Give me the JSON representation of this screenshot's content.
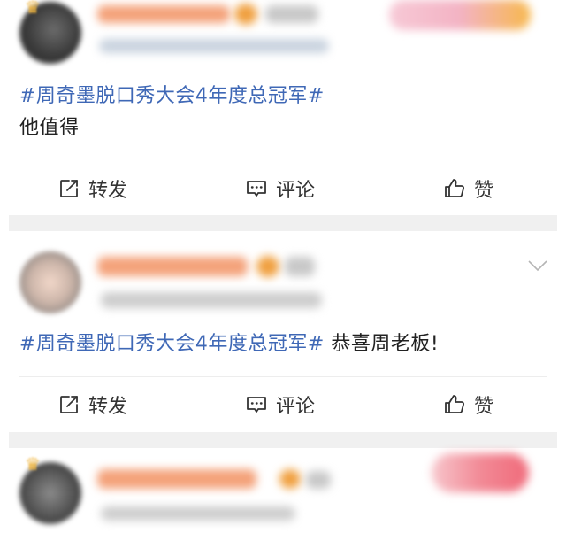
{
  "posts": [
    {
      "hashtag": "#周奇墨脱口秀大会4年度总冠军#",
      "body": "他值得",
      "actions": {
        "repost": "转发",
        "comment": "评论",
        "like": "赞"
      }
    },
    {
      "hashtag": "#周奇墨脱口秀大会4年度总冠军#",
      "body": " 恭喜周老板!",
      "actions": {
        "repost": "转发",
        "comment": "评论",
        "like": "赞"
      }
    },
    {}
  ],
  "icons": {
    "repost": "repost-icon",
    "comment": "comment-icon",
    "like": "thumbs-up-icon",
    "more": "chevron-down-icon"
  },
  "colors": {
    "hashtag": "#3f68b6",
    "text": "#222222",
    "separator": "#f0f0f0"
  }
}
